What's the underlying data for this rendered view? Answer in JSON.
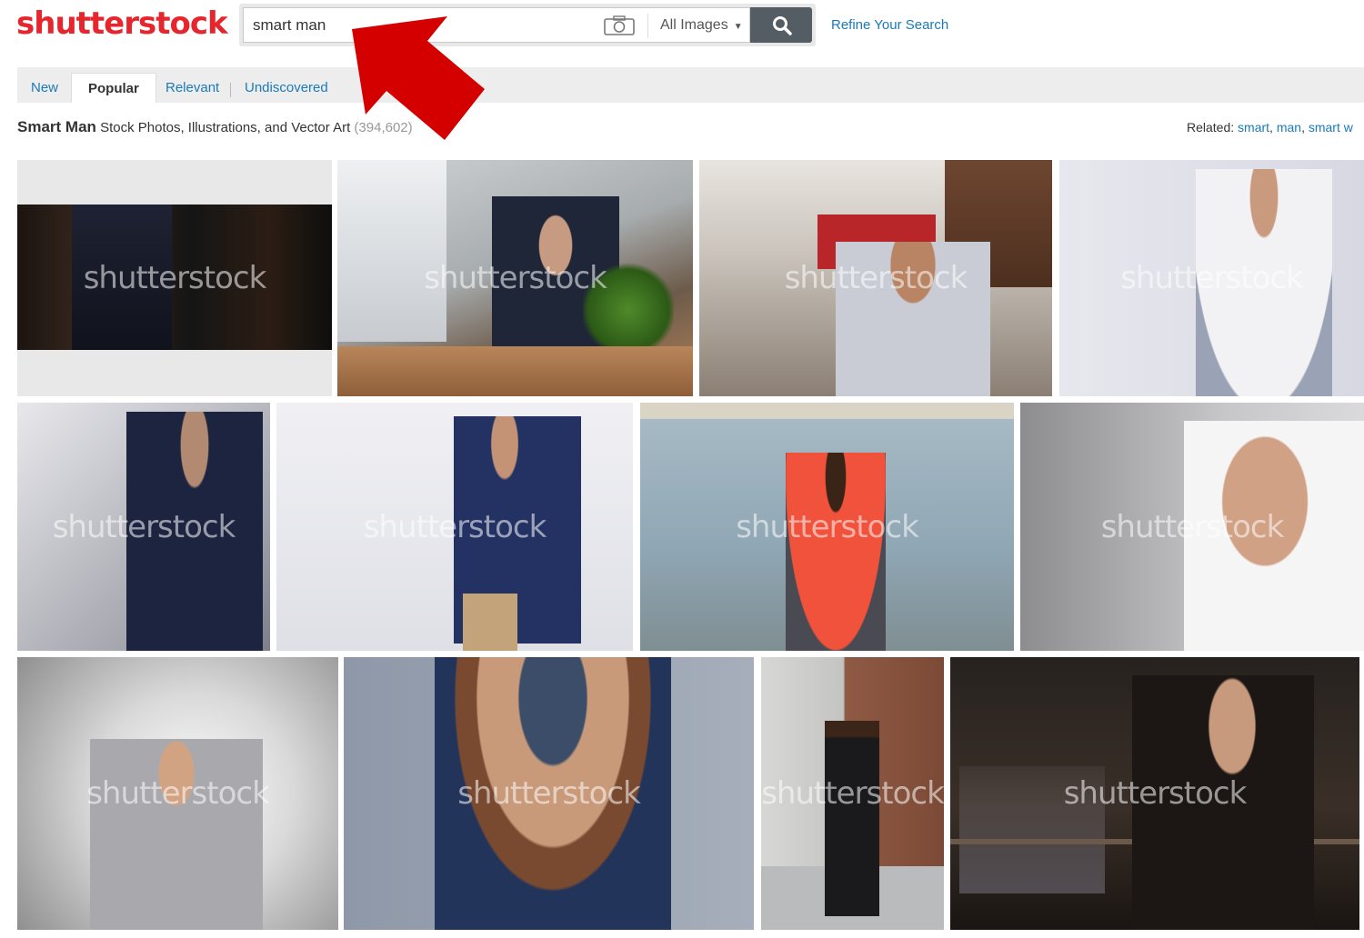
{
  "header": {
    "logo": "shutterstock",
    "search": {
      "value": "smart man",
      "placeholder": ""
    },
    "image_type": "All Images",
    "refine_link": "Refine Your Search"
  },
  "tabs": [
    "New",
    "Popular",
    "Relevant",
    "Undiscovered"
  ],
  "active_tab": "Popular",
  "results": {
    "query": "Smart Man",
    "subtitle": "Stock Photos, Illustrations, and Vector Art",
    "count": "(394,602)"
  },
  "related": {
    "label": "Related:",
    "links": [
      "smart",
      "man",
      "smart w"
    ]
  },
  "watermark": "shutterstock",
  "colors": {
    "brand": "#e6262c",
    "link": "#1a7ab8",
    "annotation_arrow": "#d40000"
  }
}
